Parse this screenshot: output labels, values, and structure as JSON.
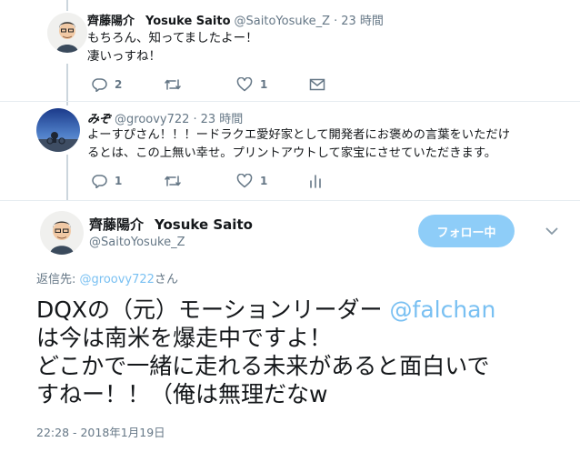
{
  "tweet1": {
    "display_name": "齊藤陽介",
    "name_en": "Yosuke Saito",
    "handle": "@SaitoYosuke_Z",
    "dot": "·",
    "time": "23 時間",
    "lines": [
      "もちろん、知ってましたよー！",
      "凄いっすね！"
    ],
    "replies": "2",
    "retweets": "",
    "likes": "1"
  },
  "tweet2": {
    "display_name": "みぞ",
    "handle": "@groovy722",
    "dot": "·",
    "time": "23 時間",
    "lines": [
      "よーすぴさん！！！ードラクエ愛好家として開発者にお褒めの言葉をいただけ",
      "るとは、この上無い幸せ。プリントアウトして家宝にさせていただきます。"
    ],
    "replies": "1",
    "retweets": "",
    "likes": "1"
  },
  "main_tweet": {
    "display_name": "齊藤陽介",
    "name_en": "Yosuke Saito",
    "handle": "@SaitoYosuke_Z",
    "follow_label": "フォロー中",
    "reply_to_prefix": "返信先: ",
    "reply_to_handle": "@groovy722",
    "reply_to_suffix": "さん",
    "text_line1_a": "DQXの（元）モーションリーダー ",
    "text_line1_mention": "@falchan",
    "text_line2": "は今は南米を爆走中ですよ！",
    "text_line3": "どこかで一緒に走れる未来があると面白いで",
    "text_line4": "すねー！！（俺は無理だなw",
    "timestamp": "22:28 - 2018年1月19日"
  },
  "colors": {
    "text": "#14171a",
    "muted": "#657786",
    "link": "#79c0f2",
    "follow_bg": "#8ecdf8",
    "separator": "#e6ecf0"
  },
  "icons": [
    "reply-icon",
    "retweet-icon",
    "heart-icon",
    "mail-icon",
    "analytics-icon",
    "chevron-down-icon"
  ]
}
